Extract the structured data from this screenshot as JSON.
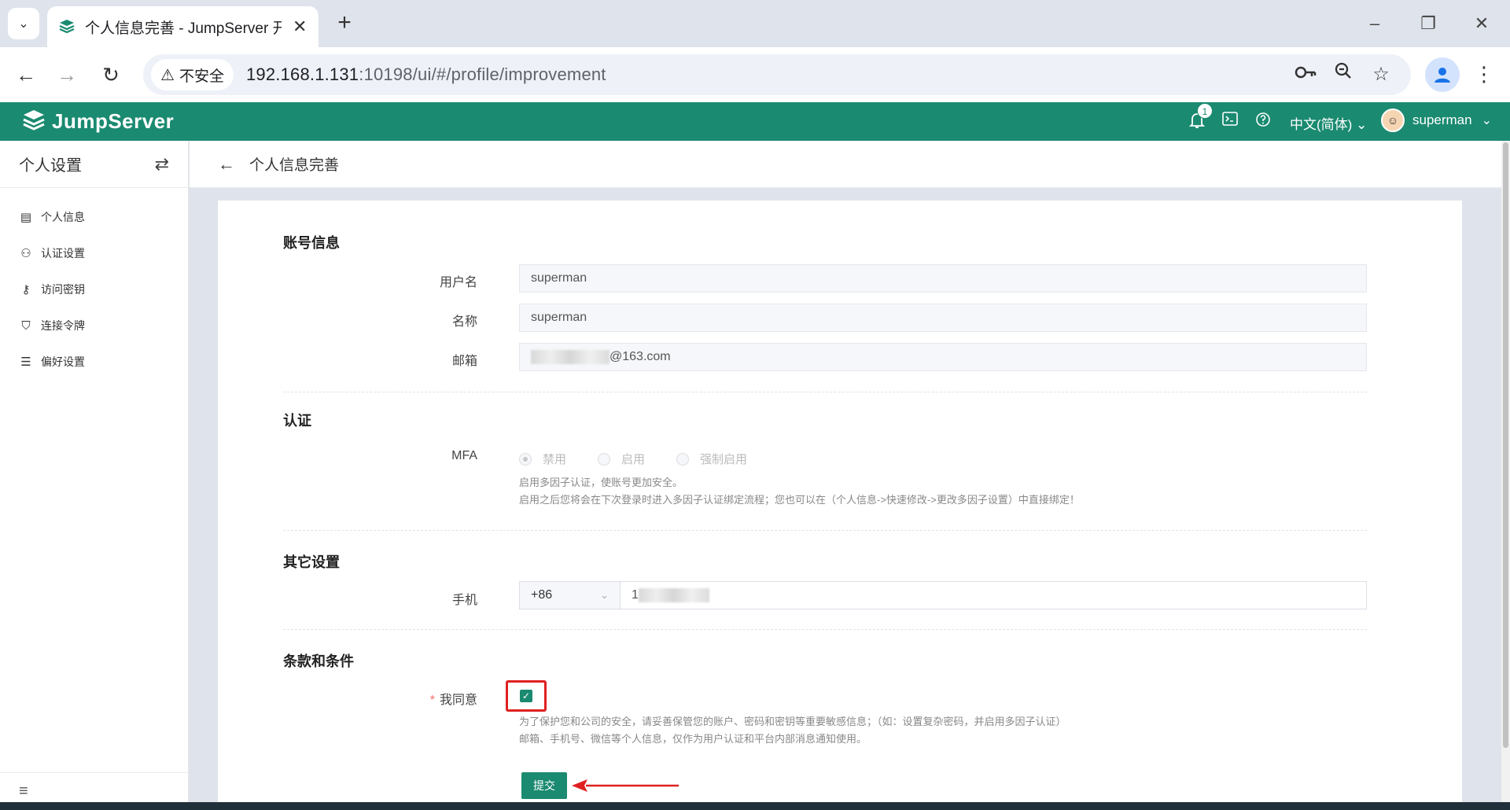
{
  "browser": {
    "tab_title": "个人信息完善 - JumpServer 开",
    "security_label": "不安全",
    "url_host": "192.168.1.131",
    "url_rest": ":10198/ui/#/profile/improvement"
  },
  "header": {
    "logo": "JumpServer",
    "notification_count": "1",
    "language": "中文(简体)",
    "username": "superman"
  },
  "sidebar": {
    "title": "个人设置",
    "items": [
      {
        "label": "个人信息",
        "icon": "id-card-icon"
      },
      {
        "label": "认证设置",
        "icon": "user-auth-icon"
      },
      {
        "label": "访问密钥",
        "icon": "key-icon"
      },
      {
        "label": "连接令牌",
        "icon": "token-icon"
      },
      {
        "label": "偏好设置",
        "icon": "sliders-icon"
      }
    ]
  },
  "page": {
    "title": "个人信息完善"
  },
  "form": {
    "account_section": "账号信息",
    "username_label": "用户名",
    "username_value": "superman",
    "name_label": "名称",
    "name_value": "superman",
    "email_label": "邮箱",
    "email_suffix": "@163.com",
    "auth_section": "认证",
    "mfa_label": "MFA",
    "mfa_options": [
      "禁用",
      "启用",
      "强制启用"
    ],
    "mfa_selected": "禁用",
    "mfa_help_1": "启用多因子认证，使账号更加安全。",
    "mfa_help_2": "启用之后您将会在下次登录时进入多因子认证绑定流程；您也可以在（个人信息->快速修改->更改多因子设置）中直接绑定！",
    "other_section": "其它设置",
    "phone_label": "手机",
    "phone_code": "+86",
    "phone_prefix": "1",
    "terms_section": "条款和条件",
    "agree_label": "我同意",
    "agree_checked": true,
    "terms_help_1": "为了保护您和公司的安全，请妥善保管您的账户、密码和密钥等重要敏感信息；（如：设置复杂密码，并启用多因子认证）",
    "terms_help_2": "邮箱、手机号、微信等个人信息，仅作为用户认证和平台内部消息通知使用。",
    "submit_label": "提交"
  },
  "colors": {
    "brand": "#1a8a70",
    "highlight": "#e02020"
  }
}
